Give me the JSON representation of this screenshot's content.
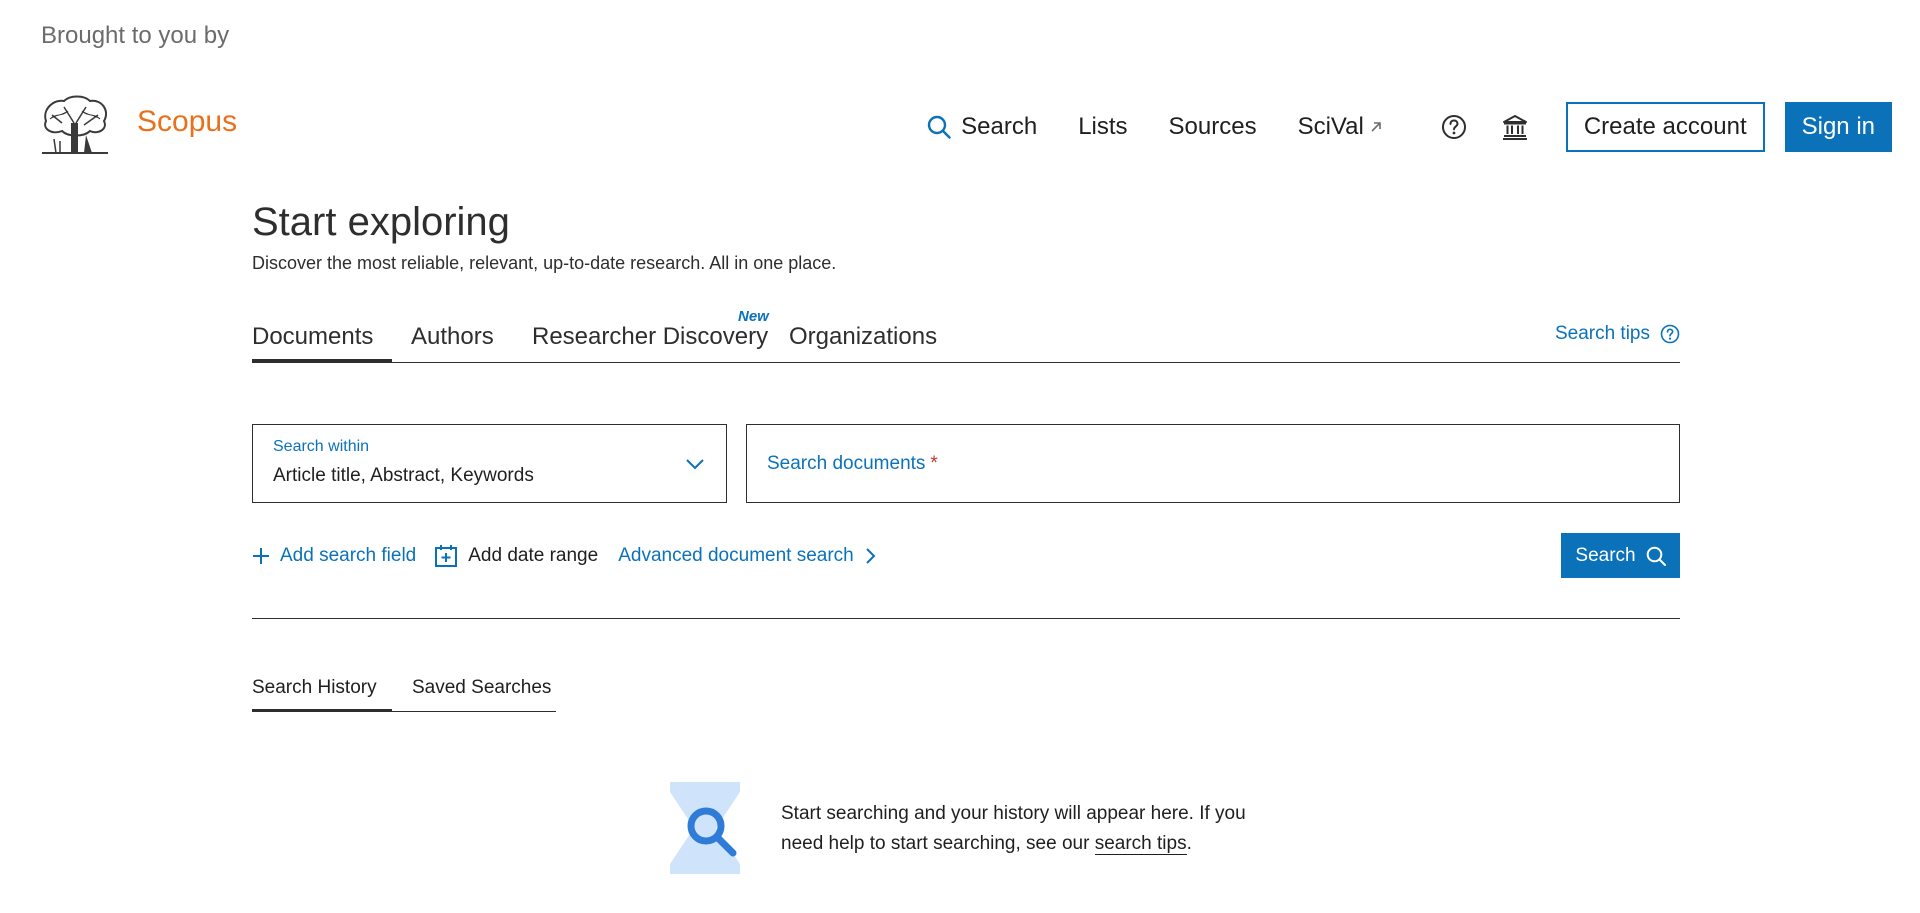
{
  "header": {
    "brought_to_you_by": "Brought to you by",
    "brand": "Scopus",
    "nav": {
      "search": "Search",
      "lists": "Lists",
      "sources": "Sources",
      "scival": "SciVal"
    },
    "icons": [
      "help-circle-icon",
      "institution-icon",
      "external-link-icon"
    ],
    "create_account": "Create account",
    "sign_in": "Sign in"
  },
  "main": {
    "title": "Start exploring",
    "subtitle": "Discover the most reliable, relevant, up-to-date research. All in one place.",
    "tabs": [
      {
        "label": "Documents",
        "selected": true
      },
      {
        "label": "Authors"
      },
      {
        "label": "Researcher Discovery",
        "badge": "New"
      },
      {
        "label": "Organizations"
      }
    ],
    "search_tips": "Search tips",
    "search_within": {
      "label": "Search within",
      "value": "Article title, Abstract, Keywords"
    },
    "search_documents": {
      "label": "Search documents",
      "required_mark": "*"
    },
    "actions": {
      "add_field": "Add search field",
      "add_date": "Add date range",
      "advanced": "Advanced document search"
    },
    "search_button": "Search"
  },
  "history": {
    "tabs": [
      {
        "label": "Search History",
        "selected": true
      },
      {
        "label": "Saved Searches"
      }
    ],
    "empty_text_before": "Start searching and your history will appear here. If you need help to start searching, see our ",
    "empty_link": "search tips",
    "empty_text_after": "."
  },
  "colors": {
    "accent": "#0b72b9",
    "brand": "#e9711c",
    "text": "#2e2e2e",
    "required": "#c83727",
    "illustration_light": "#cfe3fb",
    "illustration_dark": "#2f7bd8"
  }
}
